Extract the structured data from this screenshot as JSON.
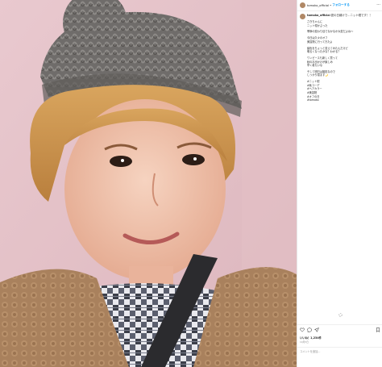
{
  "post": {
    "username": "tomoko_official",
    "follow_label": "フォローする",
    "caption_first": "夏の日焼けで…ニット帽です！！",
    "caption_lines": [
      "さきちゃんに",
      "ニット帽かぶった",
      "",
      "季節の変わり目でなかなか大変だよね〜",
      "",
      "今日は久々のオフ",
      "美容院に行ってきたよ",
      "",
      "髪色をちょっと変えてみたんだけど",
      "明るくなったかな？わかる？",
      "",
      "ワンピースも新しく買って",
      "秋のお出かけが楽しみ",
      "早く着たいな",
      "",
      "そして明日は撮影なので",
      "しっかり寝ます🌙",
      "",
      "#ニット帽",
      "#秋コーデ",
      "#ヘアカラー",
      "#美容院",
      "#オフの日",
      "#tomoko"
    ],
    "likes": "いいね！1,234件",
    "date": "10月5日",
    "comment_placeholder": "コメントを追加…",
    "more_glyph": "···"
  }
}
